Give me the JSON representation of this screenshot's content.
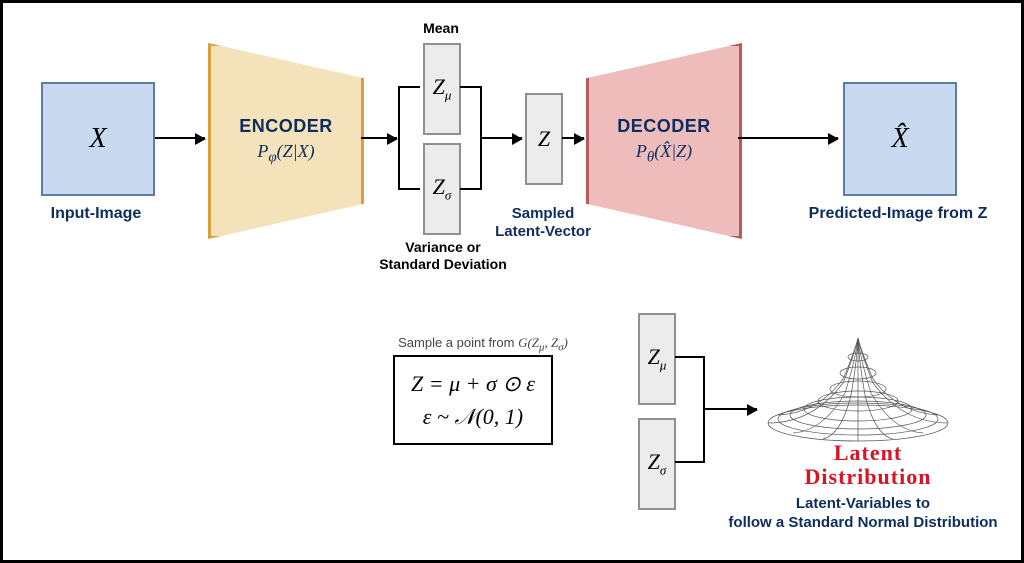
{
  "colors": {
    "box_fill": "#c9d9ef",
    "box_border": "#5e7aa5",
    "encoder_fill": "#f4e2bb",
    "encoder_border": "#d9a13b",
    "decoder_fill": "#efbcbc",
    "decoder_border": "#b25b5b",
    "label_navy": "#0d2d5e",
    "latent_red": "#d81324"
  },
  "top": {
    "input_symbol": "X",
    "input_label": "Input-Image",
    "encoder_title": "ENCODER",
    "encoder_sub": "Pφ(Z|X)",
    "mean_label": "Mean",
    "z_mu": "Zμ",
    "variance_label": "Variance or\nStandard Deviation",
    "z_sigma": "Zσ",
    "z_symbol": "Z",
    "sampled_label": "Sampled\nLatent-Vector",
    "decoder_title": "DECODER",
    "decoder_sub": "Pθ(X̂|Z)",
    "output_symbol": "X̂",
    "output_label": "Predicted-Image from Z"
  },
  "bottom": {
    "sample_caption": "Sample a point from G(Zμ, Zσ)",
    "formula_line1": "Z = μ + σ ⊙ ε",
    "formula_line2": "ε ~ 𝒩(0, 1)",
    "z_mu": "Zμ",
    "z_sigma": "Zσ",
    "latent_title": "Latent\nDistribution",
    "latent_caption": "Latent-Variables to\nfollow a Standard Normal Distribution"
  }
}
